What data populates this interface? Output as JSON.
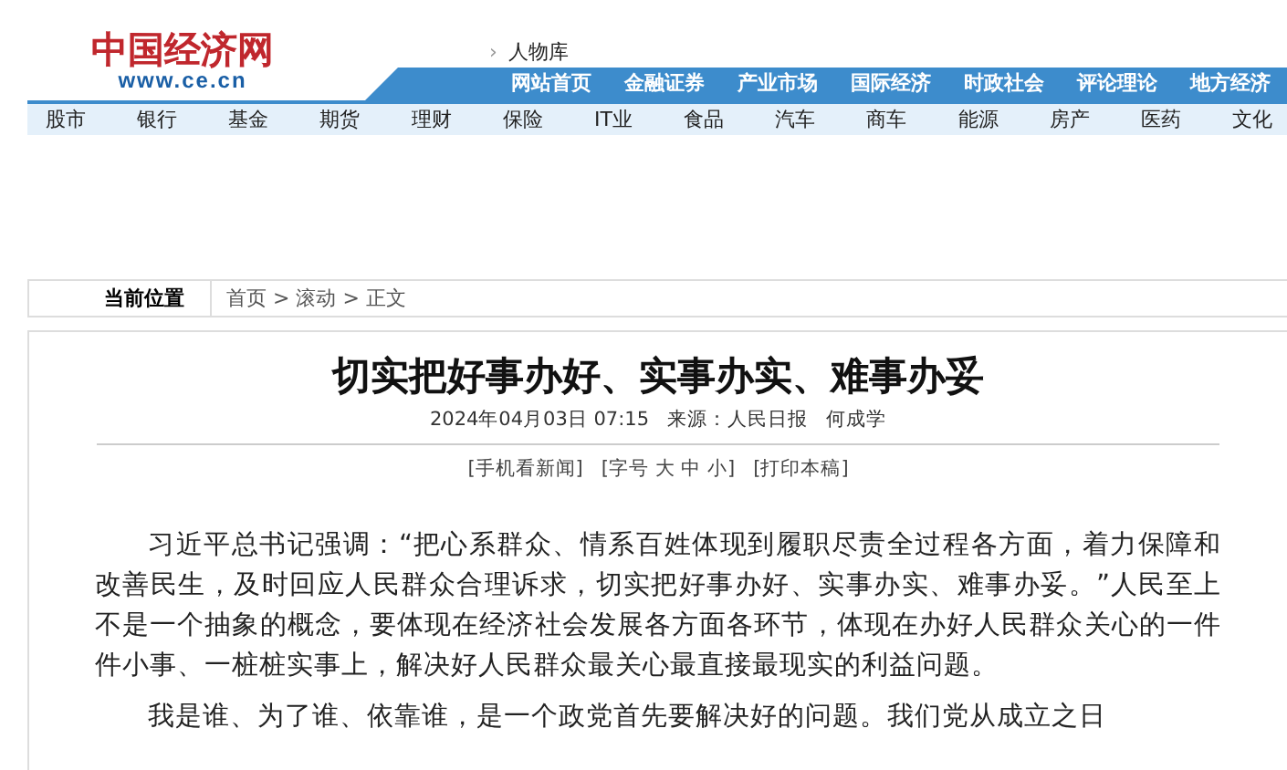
{
  "logo": {
    "name": "中国经济网",
    "url": "www.ce.cn"
  },
  "channel": {
    "marker": "›",
    "label": "人物库"
  },
  "main_nav": [
    "网站首页",
    "金融证券",
    "产业市场",
    "国际经济",
    "时政社会",
    "评论理论",
    "地方经济"
  ],
  "sub_nav": [
    "股市",
    "银行",
    "基金",
    "期货",
    "理财",
    "保险",
    "IT业",
    "食品",
    "汽车",
    "商车",
    "能源",
    "房产",
    "医药",
    "文化"
  ],
  "breadcrumb": {
    "label": "当前位置",
    "path": "首页 > 滚动 > 正文"
  },
  "article": {
    "title": "切实把好事办好、实事办实、难事办妥",
    "meta": "2024年04月03日 07:15   来源：人民日报   何成学",
    "tools": [
      "[手机看新闻]",
      "[字号 大 中 小]",
      "[打印本稿]"
    ],
    "paragraphs": [
      "习近平总书记强调：“把心系群众、情系百姓体现到履职尽责全过程各方面，着力保障和改善民生，及时回应人民群众合理诉求，切实把好事办好、实事办实、难事办妥。”人民至上不是一个抽象的概念，要体现在经济社会发展各方面各环节，体现在办好人民群众关心的一件件小事、一桩桩实事上，解决好人民群众最关心最直接最现实的利益问题。",
      "我是谁、为了谁、依靠谁，是一个政党首先要解决好的问题。我们党从成立之日"
    ]
  }
}
